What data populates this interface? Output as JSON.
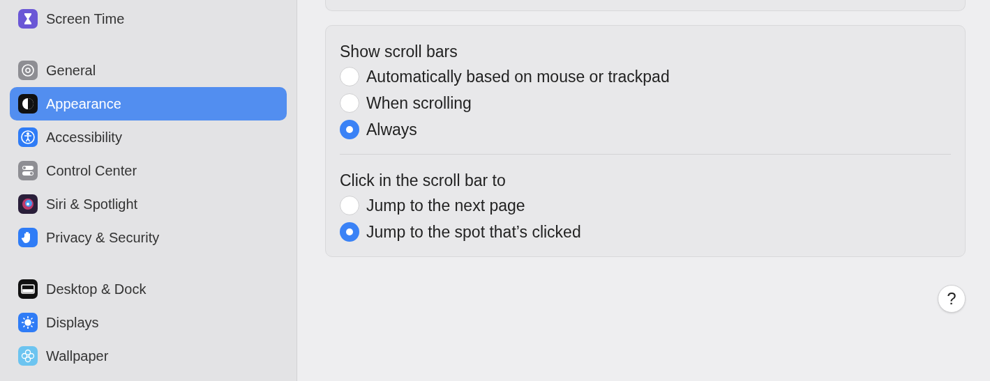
{
  "sidebar": {
    "groups": [
      {
        "items": [
          {
            "label": "Screen Time",
            "selected": false
          }
        ]
      },
      {
        "items": [
          {
            "label": "General",
            "selected": false
          },
          {
            "label": "Appearance",
            "selected": true
          },
          {
            "label": "Accessibility",
            "selected": false
          },
          {
            "label": "Control Center",
            "selected": false
          },
          {
            "label": "Siri & Spotlight",
            "selected": false
          },
          {
            "label": "Privacy & Security",
            "selected": false
          }
        ]
      },
      {
        "items": [
          {
            "label": "Desktop & Dock",
            "selected": false
          },
          {
            "label": "Displays",
            "selected": false
          },
          {
            "label": "Wallpaper",
            "selected": false
          }
        ]
      }
    ]
  },
  "sections": [
    {
      "title": "Show scroll bars",
      "options": [
        {
          "label": "Automatically based on mouse or trackpad",
          "selected": false
        },
        {
          "label": "When scrolling",
          "selected": false
        },
        {
          "label": "Always",
          "selected": true
        }
      ]
    },
    {
      "title": "Click in the scroll bar to",
      "options": [
        {
          "label": "Jump to the next page",
          "selected": false
        },
        {
          "label": "Jump to the spot that’s clicked",
          "selected": true
        }
      ]
    }
  ],
  "help_button": {
    "label": "?"
  }
}
